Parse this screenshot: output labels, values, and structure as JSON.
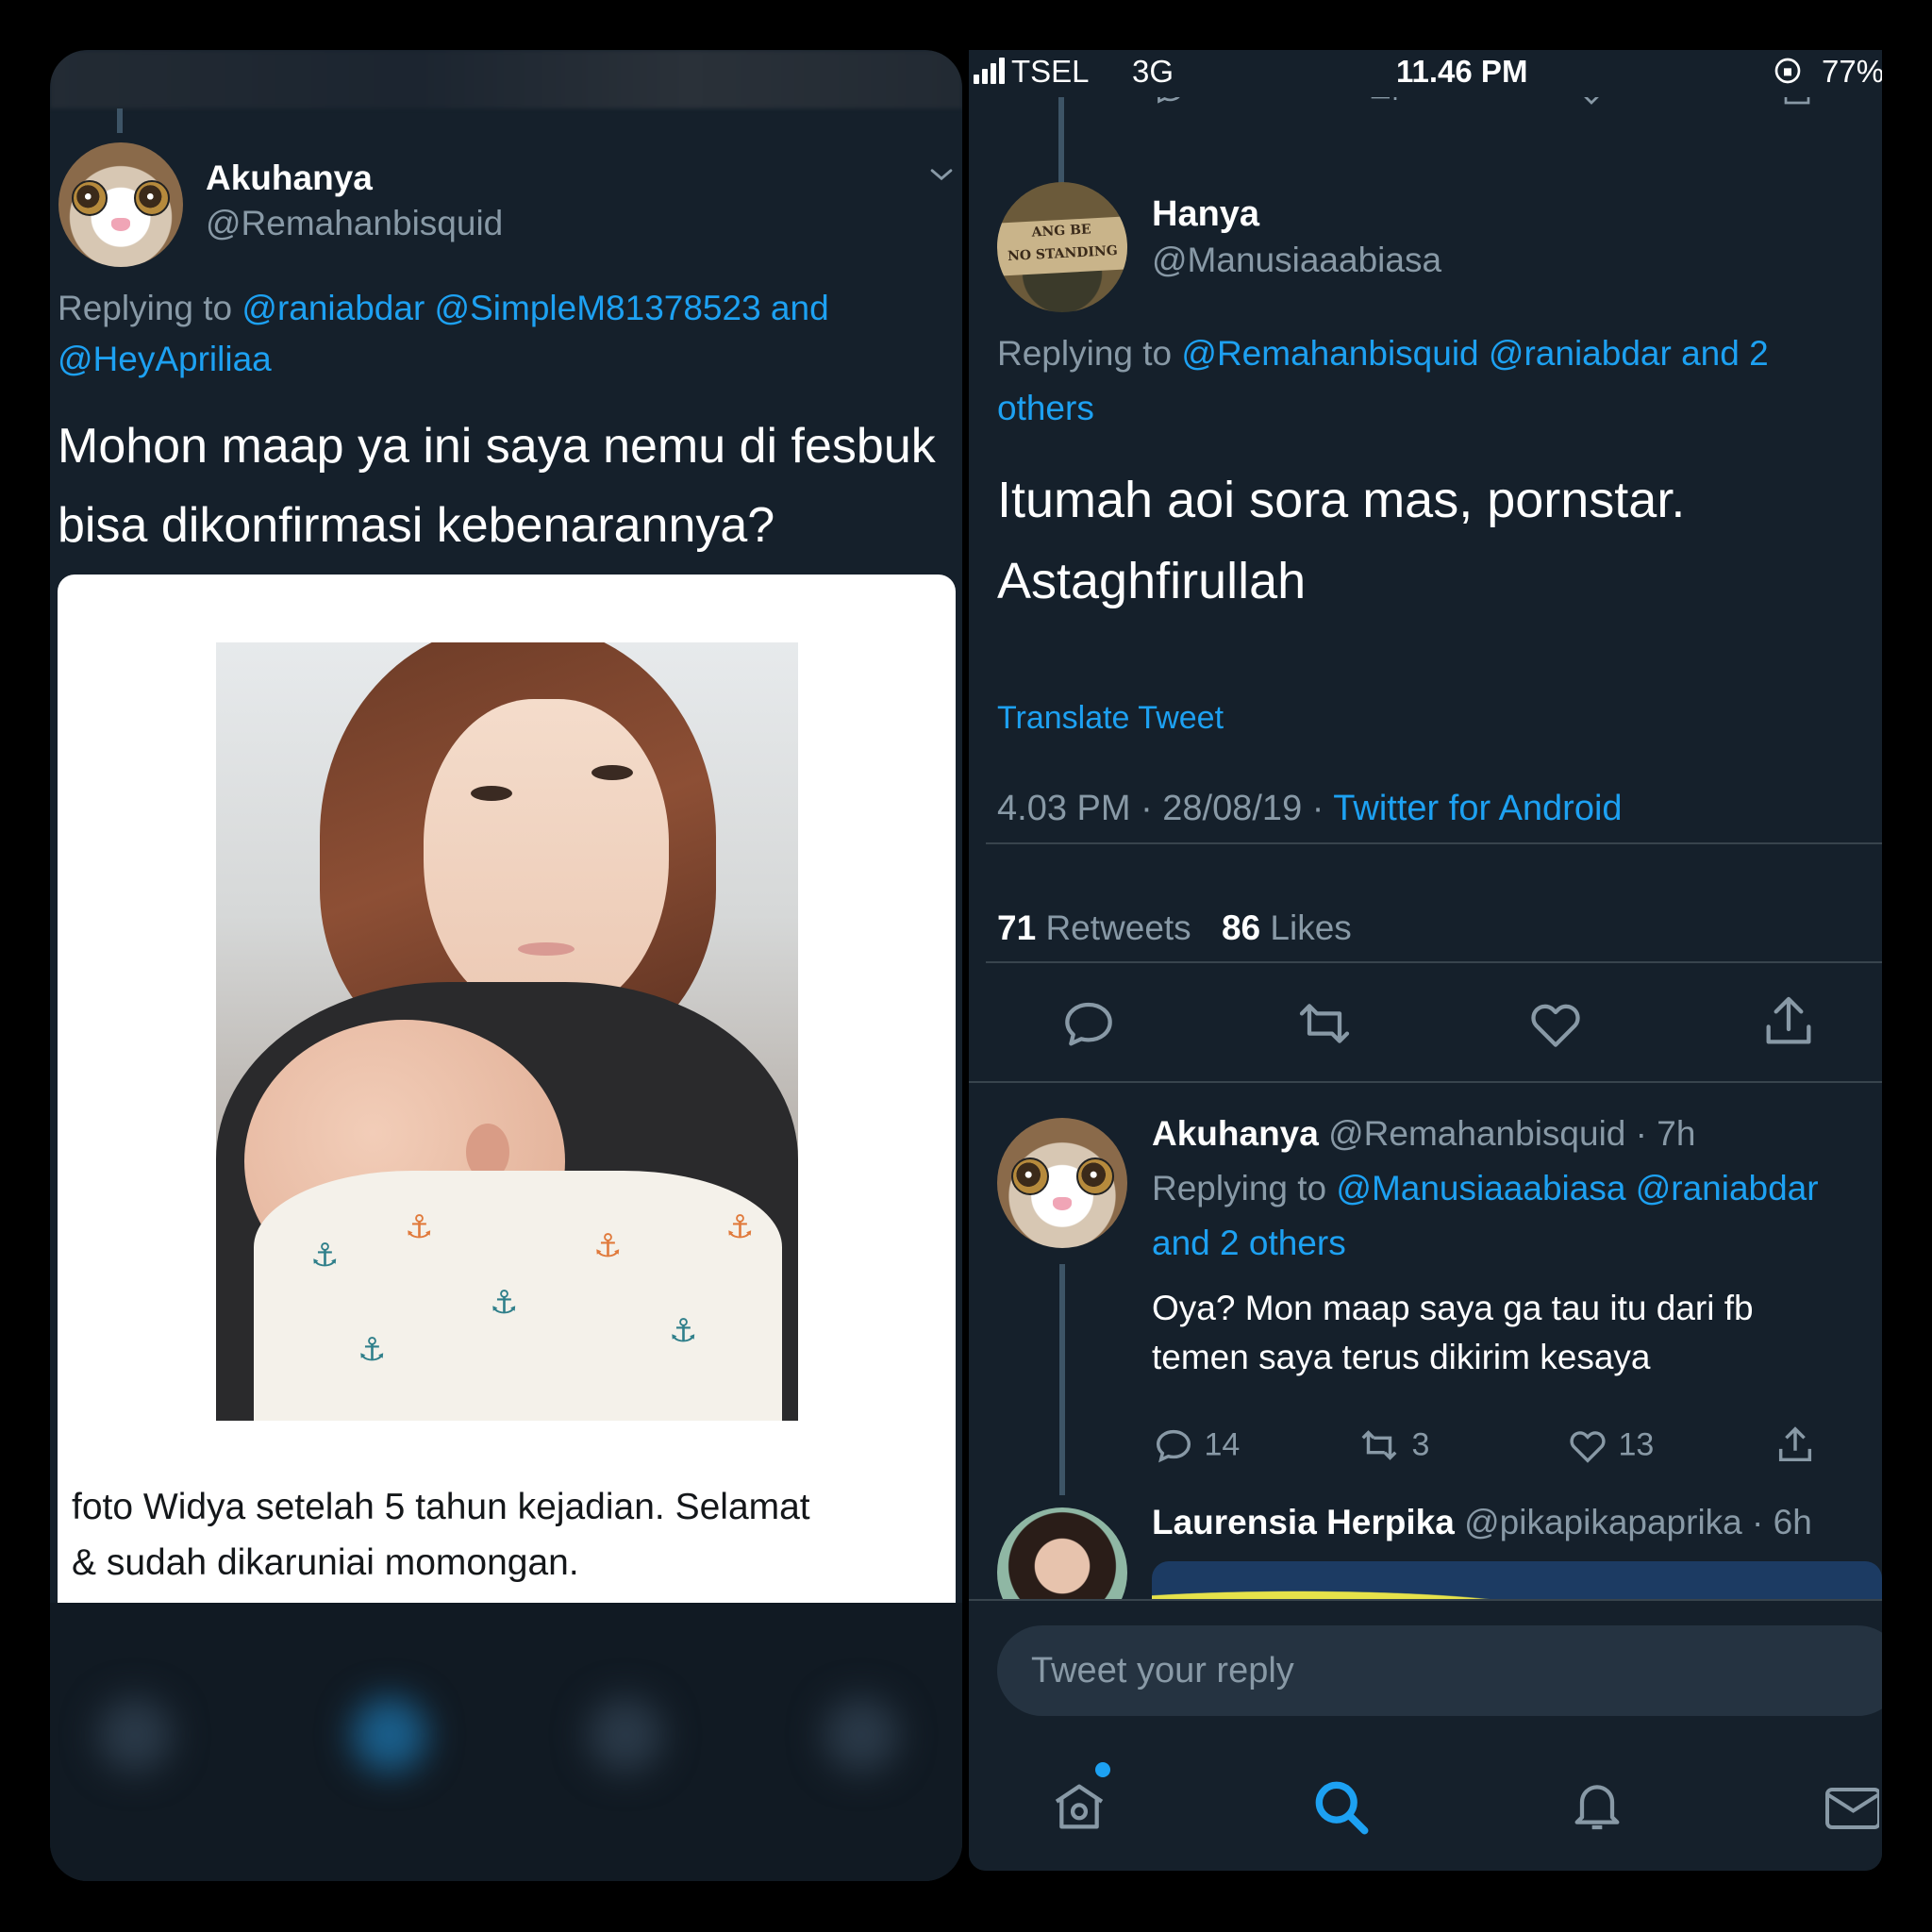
{
  "colors": {
    "background": "#15202b",
    "accent": "#1da1f2",
    "muted": "#8899a6",
    "divider": "#38444d"
  },
  "left": {
    "author": {
      "name": "Akuhanya",
      "handle": "@Remahanbisquid"
    },
    "replying_prefix": "Replying to",
    "replying_links": "@raniabdar @SimpleM81378523 and",
    "replying_links_2": "@HeyApriliaa",
    "text_line1": "Mohon maap ya ini saya nemu di fesbuk",
    "text_line2": "bisa dikonfirmasi kebenarannya?",
    "caption_line1": "foto Widya setelah 5 tahun kejadian. Selamat",
    "caption_line2": "& sudah dikaruniai momongan."
  },
  "status_bar": {
    "carrier": "TSEL",
    "network": "3G",
    "time": "11.46 PM",
    "battery": "77%"
  },
  "main_tweet": {
    "name": "Hanya",
    "handle": "@Manusiaaabiasa",
    "avatar_text_1": "ANG BE",
    "avatar_text_2": "NO STANDING",
    "replying_prefix": "Replying to",
    "replying_links": "@Remahanbisquid @raniabdar and 2",
    "replying_links_2": "others",
    "text_line1": "Itumah aoi sora mas, pornstar.",
    "text_line2": "Astaghfirullah",
    "translate": "Translate Tweet",
    "timestamp": "4.03 PM · 28/08/19 · ",
    "source": "Twitter for Android",
    "retweets_count": "71",
    "retweets_label": "Retweets",
    "likes_count": "86",
    "likes_label": "Likes"
  },
  "reply1": {
    "name": "Akuhanya",
    "handle_time": "@Remahanbisquid · 7h",
    "replying_prefix": "Replying to",
    "replying_links": "@Manusiaaabiasa @raniabdar",
    "replying_links_2": "and 2 others",
    "text_line1": "Oya? Mon maap saya ga tau itu dari fb",
    "text_line2": "temen saya terus dikirim kesaya",
    "reply_count": "14",
    "retweet_count": "3",
    "like_count": "13"
  },
  "reply2": {
    "name": "Laurensia Herpika",
    "handle_time": "@pikapikapaprika · 6h"
  },
  "compose": {
    "placeholder": "Tweet your reply"
  },
  "nav": {
    "icons": [
      "home-icon",
      "search-icon",
      "notifications-icon",
      "messages-icon"
    ]
  }
}
